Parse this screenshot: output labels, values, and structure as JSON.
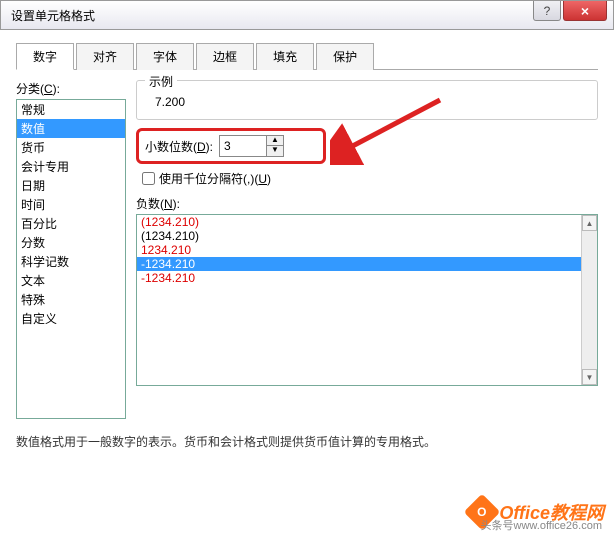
{
  "window": {
    "title": "设置单元格格式",
    "help": "?",
    "close": "×"
  },
  "tabs": [
    "数字",
    "对齐",
    "字体",
    "边框",
    "填充",
    "保护"
  ],
  "activeTab": 0,
  "category": {
    "label": "分类(C):",
    "items": [
      "常规",
      "数值",
      "货币",
      "会计专用",
      "日期",
      "时间",
      "百分比",
      "分数",
      "科学记数",
      "文本",
      "特殊",
      "自定义"
    ],
    "selectedIndex": 1
  },
  "example": {
    "label": "示例",
    "value": "7.200"
  },
  "decimal": {
    "label": "小数位数(D):",
    "value": "3"
  },
  "thousands": {
    "label": "使用千位分隔符(,)(U)",
    "checked": false
  },
  "negative": {
    "label": "负数(N):",
    "items": [
      {
        "text": "(1234.210)",
        "red": true
      },
      {
        "text": "(1234.210)",
        "red": false
      },
      {
        "text": "1234.210",
        "red": true
      },
      {
        "text": "-1234.210",
        "red": false,
        "selected": true
      },
      {
        "text": "-1234.210",
        "red": true
      }
    ]
  },
  "description": "数值格式用于一般数字的表示。货币和会计格式则提供货币值计算的专用格式。",
  "watermark": {
    "badge": "O",
    "text": "Office教程网",
    "sub": "头条号www.office26.com"
  }
}
